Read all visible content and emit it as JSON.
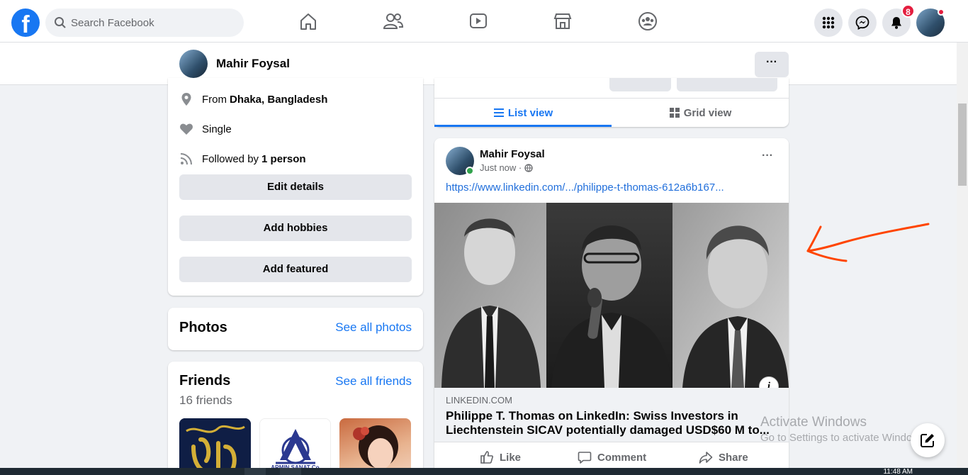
{
  "topbar": {
    "logo": "f",
    "search_placeholder": "Search Facebook",
    "nav_icons": [
      "home-icon",
      "friends-icon",
      "watch-icon",
      "marketplace-icon",
      "groups-icon"
    ],
    "notification_count": "8"
  },
  "subheader": {
    "name": "Mahir Foysal",
    "more": "···"
  },
  "intro": {
    "from_prefix": "From",
    "from_place": "Dhaka, Bangladesh",
    "relationship": "Single",
    "followed_prefix": "Followed by",
    "followed_count": "1 person",
    "edit_details": "Edit details",
    "add_hobbies": "Add hobbies",
    "add_featured": "Add featured"
  },
  "photos": {
    "title": "Photos",
    "link": "See all photos"
  },
  "friends": {
    "title": "Friends",
    "link": "See all friends",
    "count": "16 friends",
    "thumb2_text": "ARMIN SANAT Co."
  },
  "views": {
    "list": "List view",
    "grid": "Grid view"
  },
  "post": {
    "author": "Mahir Foysal",
    "time": "Just now ·",
    "more": "···",
    "link": "https://www.linkedin.com/.../philippe-t-thomas-612a6b167...",
    "domain": "LINKEDIN.COM",
    "title": "Philippe T. Thomas on LinkedIn: Swiss Investors in Liechtenstein SICAV potentially damaged USD$60 M to...",
    "info": "i",
    "actions": {
      "like": "Like",
      "comment": "Comment",
      "share": "Share"
    }
  },
  "watermark": {
    "line1": "Activate Windows",
    "line2": "Go to Settings to activate Windows."
  },
  "taskbar": {
    "clock": "11:48 AM"
  },
  "colors": {
    "accent": "#1877f2",
    "annotation": "#ff4500"
  }
}
